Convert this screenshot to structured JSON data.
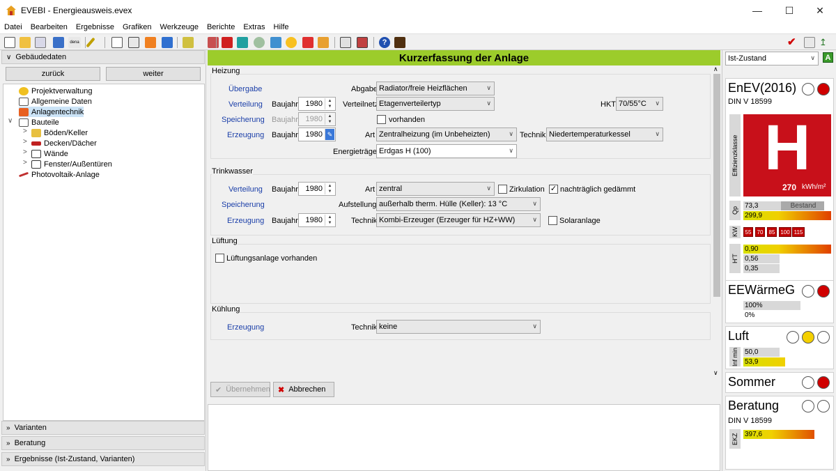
{
  "window": {
    "title": "EVEBI - Energieausweis.evex"
  },
  "menu": [
    "Datei",
    "Bearbeiten",
    "Ergebnisse",
    "Grafiken",
    "Werkzeuge",
    "Berichte",
    "Extras",
    "Hilfe"
  ],
  "left": {
    "section_title": "Gebäudedaten",
    "back": "zurück",
    "next": "weiter",
    "tree": [
      {
        "label": "Projektverwaltung",
        "icon": "gear-icon"
      },
      {
        "label": "Allgemeine Daten",
        "icon": "house-icon"
      },
      {
        "label": "Anlagentechnik",
        "icon": "fire-icon"
      },
      {
        "label": "Bauteile",
        "icon": "house-icon"
      },
      {
        "label": "Böden/Keller",
        "icon": "floor-icon"
      },
      {
        "label": "Decken/Dächer",
        "icon": "roof-icon"
      },
      {
        "label": "Wände",
        "icon": "wall-icon"
      },
      {
        "label": "Fenster/Außentüren",
        "icon": "window-icon"
      },
      {
        "label": "Photovoltaik-Anlage",
        "icon": "pv-icon"
      }
    ],
    "bottom_sections": [
      "Varianten",
      "Beratung",
      "Ergebnisse (Ist-Zustand, Varianten)"
    ]
  },
  "main": {
    "header": "Kurzerfassung der Anlage",
    "heizung": {
      "title": "Heizung",
      "uebergabe": "Übergabe",
      "abgabe_label": "Abgabe",
      "abgabe": "Radiator/freie Heizflächen",
      "verteilung": "Verteilung",
      "baujahr_label": "Baujahr",
      "verteilung_baujahr": "1980",
      "verteilnetz_label": "Verteilnetz",
      "verteilnetz": "Etagenverteilertyp",
      "hkt_label": "HKT",
      "hkt": "70/55°C",
      "speicherung": "Speicherung",
      "speicherung_baujahr": "1980",
      "vorhanden": "vorhanden",
      "erzeugung": "Erzeugung",
      "erzeugung_baujahr": "1980",
      "art_label": "Art",
      "art": "Zentralheizung (im Unbeheizten)",
      "technik_label": "Technik",
      "technik": "Niedertemperaturkessel",
      "energietraeger_label": "Energieträger",
      "energietraeger": "Erdgas H (100)"
    },
    "trinkwasser": {
      "title": "Trinkwasser",
      "verteilung": "Verteilung",
      "baujahr_label": "Baujahr",
      "verteilung_baujahr": "1980",
      "art_label": "Art",
      "art": "zentral",
      "zirkulation": "Zirkulation",
      "gedaemmt": "nachträglich gedämmt",
      "speicherung": "Speicherung",
      "aufstellung_label": "Aufstellung",
      "aufstellung": "außerhalb therm. Hülle (Keller): 13 °C",
      "erzeugung": "Erzeugung",
      "erzeugung_baujahr": "1980",
      "technik_label": "Technik",
      "technik": "Kombi-Erzeuger (Erzeuger für HZ+WW)",
      "solar": "Solaranlage"
    },
    "lueftung": {
      "title": "Lüftung",
      "anlage": "Lüftungsanlage vorhanden"
    },
    "kuehlung": {
      "title": "Kühlung",
      "erzeugung": "Erzeugung",
      "technik_label": "Technik",
      "technik": "keine"
    },
    "apply": "Übernehmen",
    "cancel": "Abbrechen"
  },
  "right": {
    "state": "Ist-Zustand",
    "enev": {
      "title": "EnEV(2016)",
      "norm": "DIN V 18599",
      "class_label": "Effizienzklasse",
      "class": "H",
      "value": "270",
      "unit": "kWh/m²",
      "qp_label": "Qp",
      "qp1": "73,3",
      "bestand": "Bestand",
      "qp2": "299,9",
      "kw_label": "KW",
      "kw": [
        "55",
        "70",
        "85",
        "100",
        "115"
      ],
      "ht_label": "H'T",
      "ht": [
        "0,90",
        "0,56",
        "0,35"
      ]
    },
    "eew": {
      "title": "EEWärmeG",
      "v1": "100%",
      "v2": "0%"
    },
    "luft": {
      "title": "Luft",
      "label": "Inf min",
      "v1": "50,0",
      "v2": "53,9"
    },
    "sommer": {
      "title": "Sommer"
    },
    "beratung": {
      "title": "Beratung",
      "norm": "DIN V 18599",
      "label": "EKZ",
      "v1": "397,6"
    }
  }
}
